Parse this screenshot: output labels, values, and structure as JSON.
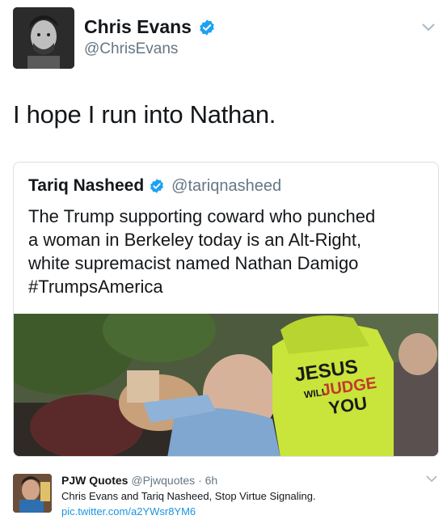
{
  "tweet": {
    "author_name": "Chris Evans",
    "author_handle": "@ChrisEvans",
    "text": "I hope I run into Nathan.",
    "icons": [
      "verified-badge-icon",
      "chevron-down-icon"
    ]
  },
  "quoted": {
    "author_name": "Tariq Nasheed",
    "author_handle": "@tariqnasheed",
    "lines": [
      "The Trump supporting coward who punched",
      "a woman in Berkeley today is an Alt-Right,",
      "white supremacist named Nathan Damigo",
      "#TrumpsAmerica"
    ],
    "media_sign": {
      "line1": "JESUS",
      "line2": "WILL",
      "line3": "JUDGE",
      "line4": "YOU"
    }
  },
  "reply": {
    "author_name": "PJW Quotes",
    "author_handle": "@Pjwquotes",
    "separator": "·",
    "time": "6h",
    "text": "Chris Evans and Tariq Nasheed, Stop Virtue Signaling.",
    "link": "pic.twitter.com/a2YWsr8YM6"
  },
  "colors": {
    "verified": "#1da1f2",
    "link": "#1b95e0",
    "muted": "#657786"
  }
}
